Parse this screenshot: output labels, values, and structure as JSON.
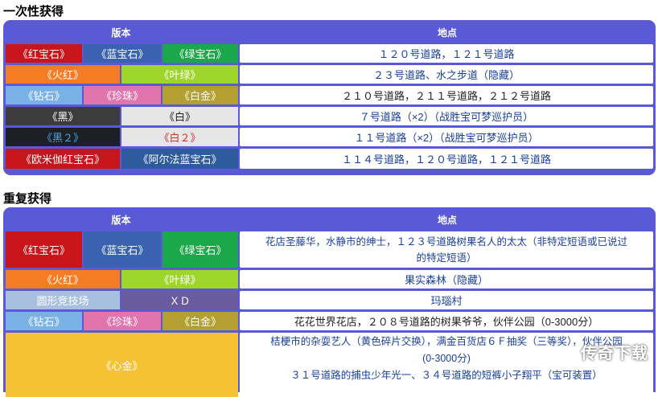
{
  "section1": {
    "title": "一次性获得",
    "col_version": "版本",
    "col_location": "地点",
    "rows": [
      {
        "versions": [
          "《红宝石》",
          "《蓝宝石》",
          "《绿宝石》"
        ],
        "location": "１２０号道路，１２１号道路"
      },
      {
        "versions": [
          "《火红》",
          "《叶绿》"
        ],
        "location": "２３号道路、水之步道（隐藏）"
      },
      {
        "versions": [
          "《钻石》",
          "《珍珠》",
          "《白金》"
        ],
        "location": "２１０号道路，２１１号道路，２１２号道路"
      },
      {
        "versions": [
          "《黑》",
          "《白》"
        ],
        "location": "７号道路（×2）（战胜宝可梦巡护员）"
      },
      {
        "versions": [
          "《黑２》",
          "《白２》"
        ],
        "location": "１１号道路（×2）（战胜宝可梦巡护员）"
      },
      {
        "versions": [
          "《欧米伽红宝石》",
          "《阿尔法蓝宝石》"
        ],
        "location": "１１４号道路，１２０号道路，１２１号道路"
      }
    ]
  },
  "section2": {
    "title": "重复获得",
    "col_version": "版本",
    "col_location": "地点",
    "rows": [
      {
        "versions": [
          "《红宝石》",
          "《蓝宝石》",
          "《绿宝石》"
        ],
        "location_lines": [
          "花店圣藤华，水静市的绅士，１２３号道路树果名人的太太（非特定短语或已说过",
          "的特定短语）"
        ]
      },
      {
        "versions": [
          "《火红》",
          "《叶绿》"
        ],
        "location": "果实森林（隐藏）"
      },
      {
        "versions": [
          "圆形竞技场",
          "ＸＤ"
        ],
        "location": "玛瑙村"
      },
      {
        "versions": [
          "《钻石》",
          "《珍珠》",
          "《白金》"
        ],
        "location": "花花世界花店，２０８号道路的树果爷爷，伙伴公园（0-3000分）"
      },
      {
        "versions": [
          "《心金》"
        ],
        "location_lines": [
          "桔梗市的杂耍艺人（黄色碎片交换），满金百货店６Ｆ抽奖（三等奖），伙伴公园",
          "(0-3000分)",
          "３１号道路的捕虫少年光一、３４号道路的短裤小子翔平（宝可装置）"
        ]
      }
    ]
  },
  "watermark": "传奇下载",
  "colors": {
    "panel": "#5a5ad6",
    "ruby": "#c8151b",
    "sapphire": "#3a62b0",
    "emerald": "#1aa84a",
    "firered": "#f57c22",
    "leafgreen": "#9ed52a",
    "diamond": "#7ab2e8",
    "pearl": "#e274ad",
    "platinum": "#b4a030",
    "black": "#3c3c3c",
    "white": "#e6e6e6",
    "black2": "#1c2024",
    "white2": "#e6e6e6",
    "omegaruby": "#c8151b",
    "alphasapphire": "#2e5b9e",
    "colosseum": "#a8bfe0",
    "xd": "#6a5a9e",
    "heartgold": "#f4c234"
  }
}
